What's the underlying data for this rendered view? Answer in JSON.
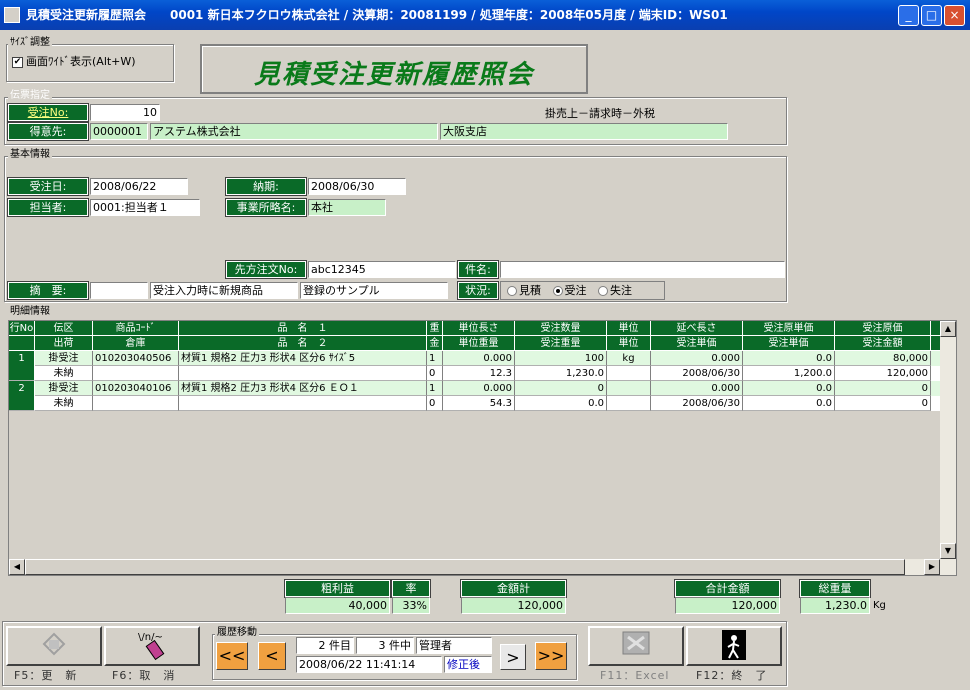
{
  "window": {
    "title": "見積受注更新履歴照会　　0001 新日本フクロウ株式会社 / 決算期：20081199 / 処理年度：2008年05月度 / 端末ID：WS01"
  },
  "size_group": {
    "label": "ｻｲｽﾞ調整",
    "checkbox_label": "画面ﾜｲﾄﾞ表示(Alt+W)",
    "checked": "✔"
  },
  "screen_title": "見積受注更新履歴照会",
  "denpyo": {
    "group_label": "伝票指定",
    "order_no_label": "受注No:",
    "order_no": "10",
    "customer_label": "得意先:",
    "customer_code": "0000001",
    "customer_name": "アステム株式会社",
    "branch": "大阪支店",
    "sales_type": "掛売上－請求時－外税"
  },
  "basic": {
    "group_label": "基本情報",
    "order_date_label": "受注日:",
    "order_date": "2008/06/22",
    "delivery_label": "納期:",
    "delivery": "2008/06/30",
    "staff_label": "担当者:",
    "staff": "0001:担当者１",
    "office_label": "事業所略名:",
    "office": "本社",
    "po_label": "先方注文No:",
    "po": "abc12345",
    "subject_label": "件名:",
    "subject": "",
    "memo_label": "摘　要:",
    "memo_code": "",
    "memo1": "受注入力時に新規商品",
    "memo2": "登録のサンプル",
    "status_label": "状況:",
    "status_options": [
      "見積",
      "受注",
      "失注"
    ]
  },
  "detail": {
    "group_label": "明細情報",
    "headers1": [
      "行No",
      "伝区",
      "商品ｺｰﾄﾞ",
      "品　名　１",
      "重",
      "単位長さ",
      "受注数量",
      "単位",
      "延べ長さ",
      "受注原単価",
      "受注原価"
    ],
    "headers2": [
      "",
      "出荷",
      "倉庫",
      "品　名　２",
      "金",
      "単位重量",
      "受注重量",
      "単位",
      "受注単価",
      "受注単価",
      "受注金額"
    ],
    "rows": [
      {
        "no": "1",
        "type": "掛受注",
        "ship": "未納",
        "code": "010203040506",
        "warehouse": "",
        "name1": "材質1 規格2 圧力3 形状4 区分6 ｻｲｽﾞ5",
        "name2": "",
        "w1": "1",
        "w2": "0",
        "unit_len": "0.000",
        "unit_wt": "12.3",
        "qty": "100",
        "qty_wt": "1,230.0",
        "unit": "kg",
        "total_len": "0.000",
        "price_date": "2008/06/30",
        "cost_unit": "0.0",
        "sale_unit": "1,200.0",
        "cost": "80,000",
        "amount": "120,000"
      },
      {
        "no": "2",
        "type": "掛受注",
        "ship": "未納",
        "code": "010203040106",
        "warehouse": "",
        "name1": "材質1 規格2 圧力3 形状4 区分6 ＥＯ１",
        "name2": "",
        "w1": "1",
        "w2": "0",
        "unit_len": "0.000",
        "unit_wt": "54.3",
        "qty": "0",
        "qty_wt": "0.0",
        "unit": "",
        "total_len": "0.000",
        "price_date": "2008/06/30",
        "cost_unit": "0.0",
        "sale_unit": "0.0",
        "cost": "0",
        "amount": "0"
      }
    ]
  },
  "totals": {
    "profit_label": "粗利益",
    "profit": "40,000",
    "rate_label": "率",
    "rate": "33%",
    "amount_label": "金額計",
    "amount": "120,000",
    "grand_label": "合計金額",
    "grand": "120,000",
    "weight_label": "総重量",
    "weight": "1,230.0",
    "weight_unit": "Kg"
  },
  "footer": {
    "f5": "F5：更　新",
    "f6": "F6：取　消",
    "history_label": "履歴移動",
    "pos": "2",
    "pos_unit": "件目",
    "count": "3",
    "count_unit": "件中",
    "user": "管理者",
    "timestamp": "2008/06/22 11:41:14",
    "state": "修正後",
    "f11": "F11：Excel",
    "f12": "F12：終　了"
  }
}
